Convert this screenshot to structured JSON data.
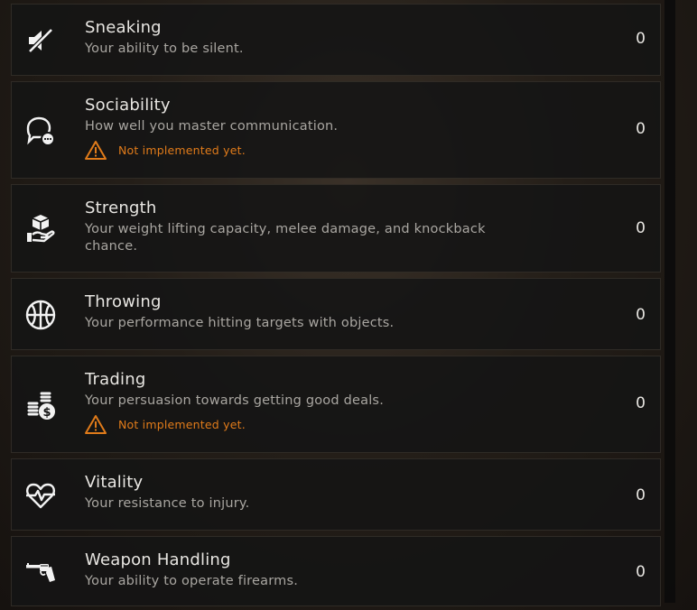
{
  "skills": [
    {
      "icon": "muted-speaker-icon",
      "name": "Sneaking",
      "description": "Your ability to be silent.",
      "value": "0",
      "warning": ""
    },
    {
      "icon": "speech-bubbles-icon",
      "name": "Sociability",
      "description": "How well you master communication.",
      "value": "0",
      "warning": "Not implemented yet."
    },
    {
      "icon": "box-on-hand-icon",
      "name": "Strength",
      "description": "Your weight lifting capacity, melee damage, and knockback chance.",
      "value": "0",
      "warning": ""
    },
    {
      "icon": "ball-icon",
      "name": "Throwing",
      "description": "Your performance hitting targets with objects.",
      "value": "0",
      "warning": ""
    },
    {
      "icon": "coin-stacks-icon",
      "name": "Trading",
      "description": "Your persuasion towards getting good deals.",
      "value": "0",
      "warning": "Not implemented yet."
    },
    {
      "icon": "heartbeat-icon",
      "name": "Vitality",
      "description": "Your resistance to injury.",
      "value": "0",
      "warning": ""
    },
    {
      "icon": "revolver-icon",
      "name": "Weapon Handling",
      "description": "Your ability to operate firearms.",
      "value": "0",
      "warning": ""
    }
  ],
  "colors": {
    "warning": "#e07b1a",
    "text_primary": "#e8e6e2",
    "text_secondary": "#a9a6a1",
    "row_background": "#141414"
  }
}
